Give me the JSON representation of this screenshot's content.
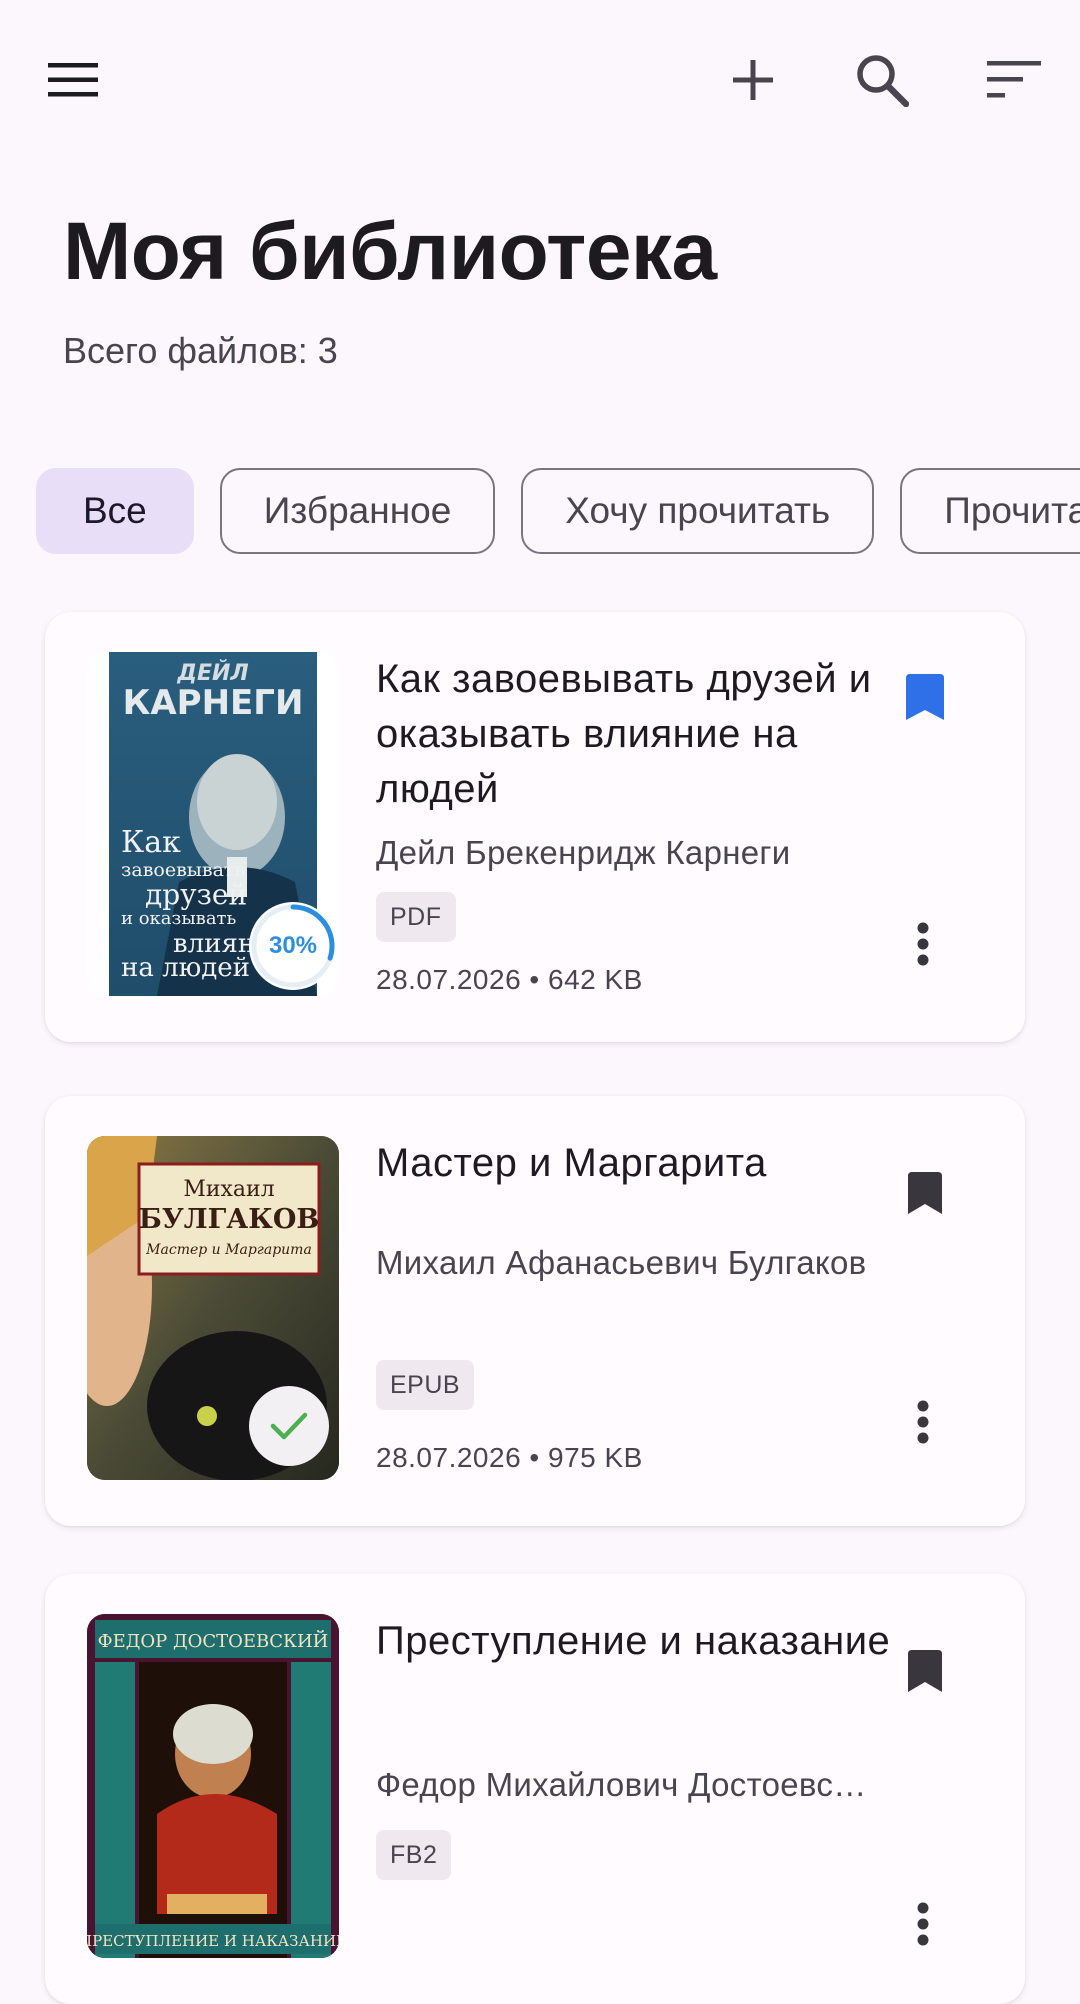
{
  "colors": {
    "background": "#fcf7fc",
    "accent_chip": "#e8def8",
    "bookmark_active": "#2f6fe8",
    "bookmark_inactive": "#3a363d",
    "progress": "#2d8ee0",
    "done_check": "#4caf50"
  },
  "toolbar": {
    "menu_icon": "hamburger-menu-icon",
    "add_icon": "plus-icon",
    "search_icon": "search-icon",
    "sort_icon": "sort-icon"
  },
  "header": {
    "title": "Моя библиотека",
    "subtitle": "Всего файлов: 3"
  },
  "filters": [
    {
      "label": "Все",
      "active": true
    },
    {
      "label": "Избранное",
      "active": false
    },
    {
      "label": "Хочу прочитать",
      "active": false
    },
    {
      "label": "Прочитано",
      "active": false
    }
  ],
  "books": [
    {
      "title": "Как завоевывать друзей и оказывать влияние на людей",
      "author": "Дейл Брекенридж Карнеги",
      "format": "PDF",
      "meta": "28.07.2026 • 642 KB",
      "bookmarked": true,
      "progress_label": "30%",
      "progress": 0.3,
      "cover": {
        "top_text": "ДЕЙЛ",
        "big_text": "КАРНЕГИ",
        "lines": [
          "Как",
          "завоевывать",
          "друзей",
          "и оказывать",
          "влияние",
          "на людей"
        ]
      }
    },
    {
      "title": "Мастер и Маргарита",
      "author": "Михаил Афанасьевич Булгаков",
      "format": "EPUB",
      "meta": "28.07.2026 • 975 KB",
      "bookmarked": false,
      "status_icon": "check-icon",
      "cover": {
        "top_text": "Михаил",
        "big_text": "БУЛГАКОВ",
        "sub_text": "Мастер и Маргарита"
      }
    },
    {
      "title": "Преступление и наказание",
      "author": "Федор Михайлович Достоевский",
      "format": "FB2",
      "meta": "",
      "bookmarked": false,
      "cover": {
        "top_text": "ФЕДОР ДОСТОЕВСКИЙ",
        "bottom_text": "ПРЕСТУПЛЕНИЕ И НАКАЗАНИЕ"
      }
    }
  ]
}
